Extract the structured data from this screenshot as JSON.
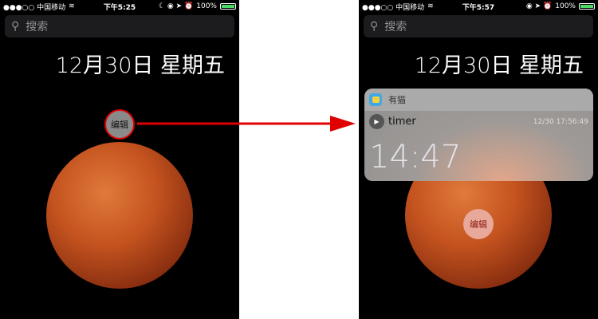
{
  "left": {
    "carrier": "●●●○○ 中国移动",
    "time": "下午5:25",
    "battery": "100%",
    "search_placeholder": "搜索",
    "date": "12月30日 星期五",
    "edit_label": "编辑"
  },
  "right": {
    "carrier": "●●●○○ 中国移动",
    "time": "下午5:57",
    "battery": "100%",
    "search_placeholder": "搜索",
    "date": "12月30日 星期五",
    "edit_label": "编辑",
    "notification": {
      "app_name": "有猫",
      "title": "timer",
      "timestamp": "12/30 17:56:49",
      "timer_value": "14:47"
    }
  },
  "colors": {
    "arrow": "#e00000",
    "battery": "#4cd964"
  }
}
